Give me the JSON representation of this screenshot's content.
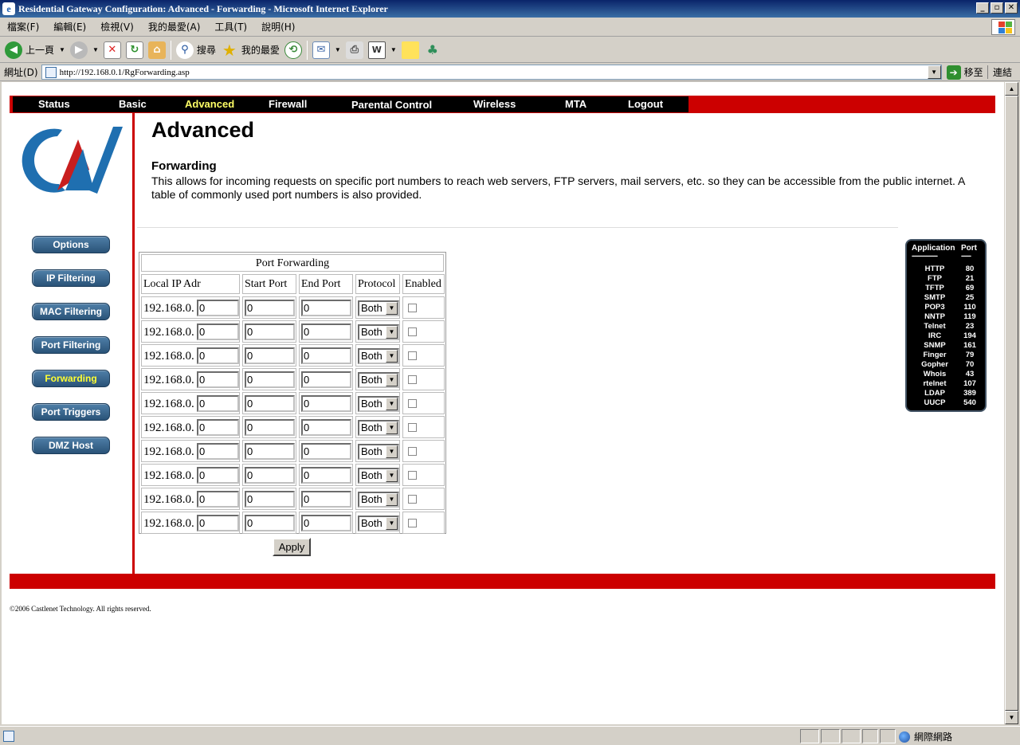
{
  "window": {
    "title": "Residential Gateway Configuration: Advanced - Forwarding - Microsoft Internet Explorer",
    "min": "_",
    "max": "▫",
    "close": "✕"
  },
  "menubar": [
    "檔案(F)",
    "編輯(E)",
    "檢視(V)",
    "我的最愛(A)",
    "工具(T)",
    "說明(H)"
  ],
  "toolbar": {
    "back_label": "上一頁",
    "search_label": "搜尋",
    "favorites_label": "我的最愛"
  },
  "addressbar": {
    "label": "網址(D)",
    "url": "http://192.168.0.1/RgForwarding.asp",
    "go_label": "移至",
    "links_label": "連結"
  },
  "topnav": [
    "Status",
    "Basic",
    "Advanced",
    "Firewall",
    "Parental Control",
    "Wireless",
    "MTA",
    "Logout"
  ],
  "topnav_active": "Advanced",
  "sidebar": [
    "Options",
    "IP Filtering",
    "MAC Filtering",
    "Port Filtering",
    "Forwarding",
    "Port Triggers",
    "DMZ Host"
  ],
  "sidebar_active": "Forwarding",
  "page": {
    "title": "Advanced",
    "section_title": "Forwarding",
    "description": "This allows for incoming requests on specific port numbers to reach  web servers, FTP servers, mail servers, etc. so they can be accessible from the public internet.  A table of commonly used port numbers is also provided."
  },
  "forwarding_table": {
    "caption": "Port Forwarding",
    "headers": [
      "Local IP Adr",
      "Start Port",
      "End Port",
      "Protocol",
      "Enabled"
    ],
    "ip_prefix": "192.168.0.",
    "rows": [
      {
        "ip_last": "0",
        "start": "0",
        "end": "0",
        "protocol": "Both",
        "enabled": false
      },
      {
        "ip_last": "0",
        "start": "0",
        "end": "0",
        "protocol": "Both",
        "enabled": false
      },
      {
        "ip_last": "0",
        "start": "0",
        "end": "0",
        "protocol": "Both",
        "enabled": false
      },
      {
        "ip_last": "0",
        "start": "0",
        "end": "0",
        "protocol": "Both",
        "enabled": false
      },
      {
        "ip_last": "0",
        "start": "0",
        "end": "0",
        "protocol": "Both",
        "enabled": false
      },
      {
        "ip_last": "0",
        "start": "0",
        "end": "0",
        "protocol": "Both",
        "enabled": false
      },
      {
        "ip_last": "0",
        "start": "0",
        "end": "0",
        "protocol": "Both",
        "enabled": false
      },
      {
        "ip_last": "0",
        "start": "0",
        "end": "0",
        "protocol": "Both",
        "enabled": false
      },
      {
        "ip_last": "0",
        "start": "0",
        "end": "0",
        "protocol": "Both",
        "enabled": false
      },
      {
        "ip_last": "0",
        "start": "0",
        "end": "0",
        "protocol": "Both",
        "enabled": false
      }
    ],
    "apply_label": "Apply"
  },
  "common_ports": {
    "header_app": "Application",
    "header_port": "Port",
    "separator_app": "----------------",
    "separator_port": "------",
    "rows": [
      {
        "app": "HTTP",
        "port": "80"
      },
      {
        "app": "FTP",
        "port": "21"
      },
      {
        "app": "TFTP",
        "port": "69"
      },
      {
        "app": "SMTP",
        "port": "25"
      },
      {
        "app": "POP3",
        "port": "110"
      },
      {
        "app": "NNTP",
        "port": "119"
      },
      {
        "app": "Telnet",
        "port": "23"
      },
      {
        "app": "IRC",
        "port": "194"
      },
      {
        "app": "SNMP",
        "port": "161"
      },
      {
        "app": "Finger",
        "port": "79"
      },
      {
        "app": "Gopher",
        "port": "70"
      },
      {
        "app": "Whois",
        "port": "43"
      },
      {
        "app": "rtelnet",
        "port": "107"
      },
      {
        "app": "LDAP",
        "port": "389"
      },
      {
        "app": "UUCP",
        "port": "540"
      }
    ]
  },
  "footer": {
    "copyright": "©2006 Castlenet Technology. All rights reserved."
  },
  "statusbar": {
    "zone": "網際網路"
  },
  "colors": {
    "brand_red": "#cc0000",
    "nav_active": "#ffff66",
    "sidebar_button": "#2a5378"
  }
}
